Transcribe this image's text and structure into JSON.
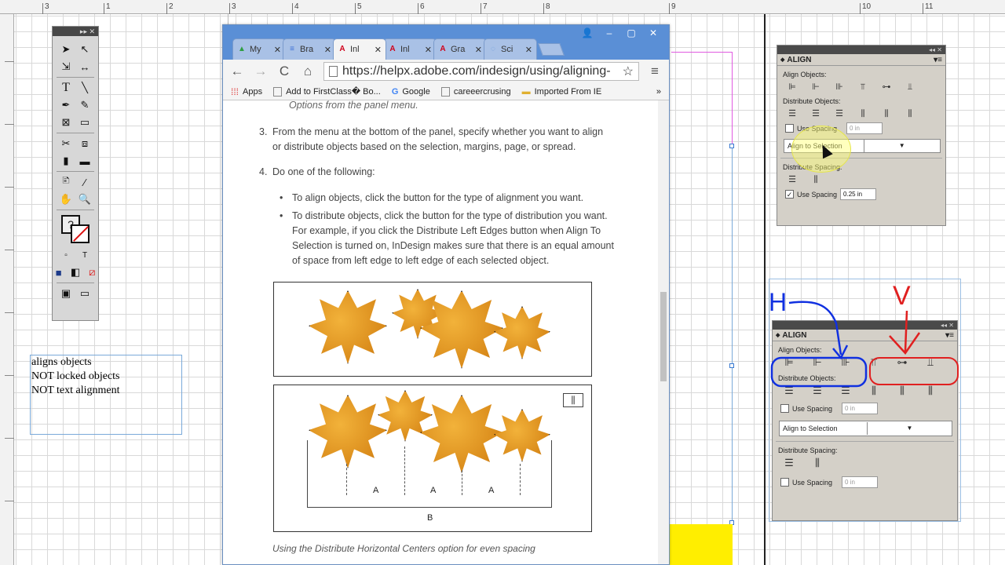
{
  "ruler": {
    "ticks": [
      "3",
      "1",
      "2",
      "3",
      "4",
      "5",
      "6",
      "7",
      "8",
      "9",
      "10",
      "11"
    ]
  },
  "tools": {
    "title_controls": "▸▸ ✕",
    "icons": [
      "selection-icon",
      "direct-selection-icon",
      "page-tool-icon",
      "gap-tool-icon",
      "type-tool-icon",
      "line-tool-icon",
      "pen-tool-icon",
      "pencil-icon",
      "rectangle-frame-icon",
      "rectangle-icon",
      "scissors-icon",
      "free-transform-icon",
      "gradient-swatch-icon",
      "gradient-feather-icon",
      "note-icon",
      "eyedropper-icon",
      "hand-icon",
      "zoom-icon"
    ],
    "fill_glyph": "?",
    "mode_t": "T"
  },
  "text_frame": {
    "lines": [
      "aligns objects",
      "NOT locked objects",
      "NOT text alignment"
    ]
  },
  "browser": {
    "tabs": [
      {
        "label": "My",
        "icon": "drive-icon",
        "icon_glyph": "▲",
        "color": "#2f9e44"
      },
      {
        "label": "Bra",
        "icon": "docs-icon",
        "icon_glyph": "≡",
        "color": "#3b6fd6"
      },
      {
        "label": "Inl",
        "icon": "adobe-icon",
        "icon_glyph": "A",
        "color": "#d0021b",
        "active": true
      },
      {
        "label": "Inl",
        "icon": "adobe-icon",
        "icon_glyph": "A",
        "color": "#d0021b"
      },
      {
        "label": "Gra",
        "icon": "adobe-icon",
        "icon_glyph": "A",
        "color": "#d0021b"
      },
      {
        "label": "Sci",
        "icon": "loading-icon",
        "icon_glyph": "◌",
        "color": "#6a9bd9"
      }
    ],
    "tab_close": "✕",
    "window_controls": {
      "user": "👤",
      "minimize": "–",
      "maximize": "▢",
      "close": "✕"
    },
    "nav": {
      "back": "←",
      "forward": "→",
      "reload": "C",
      "home": "⌂"
    },
    "url": "https://helpx.adobe.com/indesign/using/aligning-",
    "star": "☆",
    "menu": "≡",
    "bookmarks": [
      {
        "label": "Apps",
        "icon": "apps-grid-icon"
      },
      {
        "label": "Add to FirstClass� Bo...",
        "icon": "page-icon"
      },
      {
        "label": "Google",
        "icon": "google-icon"
      },
      {
        "label": "careeercrusing",
        "icon": "page-icon"
      },
      {
        "label": "Imported From IE",
        "icon": "folder-icon"
      }
    ],
    "bookmarks_more": "»"
  },
  "article": {
    "partial_line": "Options from the panel menu.",
    "step3_num": "3.",
    "step3_lines": [
      "From the menu at the bottom of the panel, specify whether you want to align",
      "or distribute objects based on the selection, margins, page, or spread."
    ],
    "step4_num": "4.",
    "step4_text": "Do one of the following:",
    "bullet1": "To align objects, click the button for the type of alignment you want.",
    "bullet2_lines": [
      "To distribute objects, click the button for the type of distribution you want.",
      "For example, if you click the Distribute Left Edges button when Align To",
      "Selection is turned on, InDesign makes sure that there is an equal amount",
      "of space from left edge to left edge of each selected object."
    ],
    "figure": {
      "labels_a": [
        "A",
        "A",
        "A"
      ],
      "label_b": "B",
      "icon_glyph": "⫼"
    },
    "caption": "Using the Distribute Horizontal Centers option for even spacing"
  },
  "align_panel_1": {
    "top_controls": "◂◂ ✕",
    "title": "ALIGN",
    "title_prefix": "◆",
    "menu_glyph": "▾≡",
    "align_objects_label": "Align Objects:",
    "distribute_objects_label": "Distribute Objects:",
    "use_spacing_label": "Use Spacing",
    "spacing_value_1": "0 in",
    "dropdown_value": "Align to Selection",
    "dropdown_arrow": "▼",
    "distribute_spacing_label": "Distribute Spacing:",
    "use_spacing_label_2": "Use Spacing",
    "spacing_value_2": "0.25 in",
    "checkbox_2_glyph": "✓"
  },
  "align_panel_2": {
    "top_controls": "◂◂ ✕",
    "title": "ALIGN",
    "title_prefix": "◆",
    "menu_glyph": "▾≡",
    "align_objects_label": "Align Objects:",
    "distribute_objects_label": "Distribute Objects:",
    "use_spacing_label": "Use Spacing",
    "spacing_value_1": "0 in",
    "dropdown_value": "Align to Selection",
    "dropdown_arrow": "▼",
    "distribute_spacing_label": "Distribute Spacing:",
    "use_spacing_label_2": "Use Spacing",
    "spacing_value_2": "0 in"
  },
  "annotations": {
    "h_label": "H",
    "v_label": "V",
    "h_color": "#1030e0",
    "v_color": "#e02020"
  },
  "icon_glyphs": {
    "align_left": "⊫",
    "align_hcenter": "⊩",
    "align_right": "⊪",
    "align_top": "⫪",
    "align_vcenter": "⊶",
    "align_bottom": "⫫",
    "dist_top": "☰",
    "dist_vcenter": "☰",
    "dist_bottom": "☰",
    "dist_left": "⫼",
    "dist_hcenter": "⫼",
    "dist_right": "⫼",
    "space_v": "☰",
    "space_h": "⫼"
  },
  "colors": {
    "chrome_blue": "#5a8fd6",
    "panel_grey": "#d4d0c8",
    "yellow_block": "#ffee00"
  }
}
